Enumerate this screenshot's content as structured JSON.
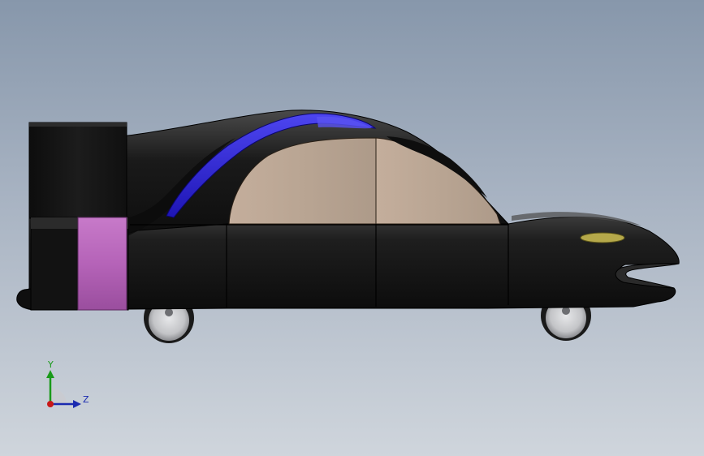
{
  "viewport": {
    "background_top": "#8797ab",
    "background_bottom": "#cfd5dc"
  },
  "model": {
    "icon": "car-body-3d-model",
    "colors": {
      "body": "#141414",
      "window": "#b9a593",
      "canopy_accent": "#2a1fd6",
      "rear_band": "#b563b8",
      "side_light": "#b5a84a",
      "wheel": "#c8c9cc"
    }
  },
  "triad": {
    "y_label": "Y",
    "z_label": "Z",
    "colors": {
      "y": "#1a9a1a",
      "z": "#1a2ab0",
      "x": "#c81818"
    }
  }
}
